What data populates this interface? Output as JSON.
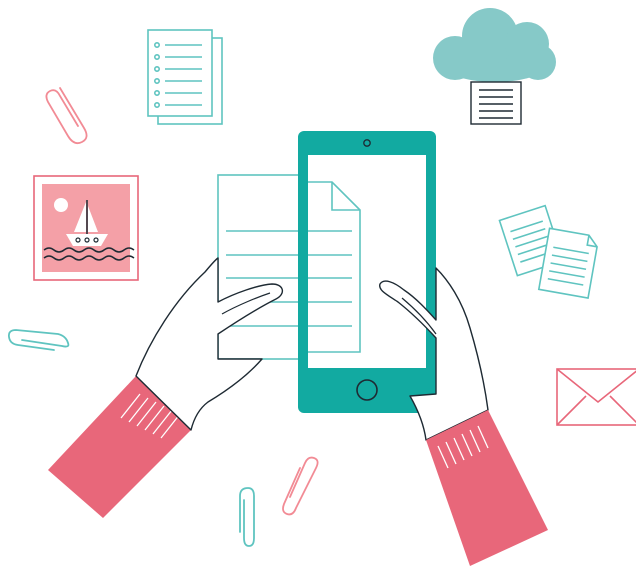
{
  "illustration": {
    "subject": "hands-holding-phone-scanning-document",
    "colors": {
      "teal": "#12aaa1",
      "teal_light": "#5fc4c0",
      "cloud": "#86c9c8",
      "coral": "#e8677a",
      "pink": "#f28b95",
      "pink_light": "#f4a0a7",
      "ink": "#1e2a33",
      "white": "#ffffff"
    },
    "icons": [
      "checklist-document-icon",
      "cloud-storage-icon",
      "paperclip-icon",
      "photo-frame-icon",
      "documents-stack-icon",
      "envelope-icon",
      "smartphone-icon",
      "paper-sheet-icon",
      "hand-icon"
    ]
  }
}
